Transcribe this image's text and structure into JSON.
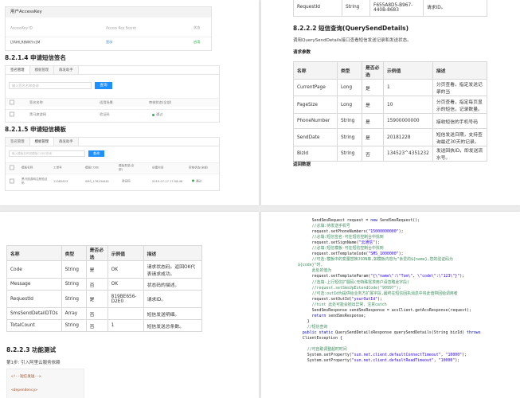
{
  "top_left": {
    "accesskey_panel": {
      "title": "用户AccessKey",
      "headers": [
        "AccessKey ID",
        "Access Key Secret",
        "状态"
      ],
      "row": {
        "id": "LTAIHLR8WKYn1M",
        "secret": "显示",
        "status": "启用"
      }
    },
    "sec_sign": {
      "heading": "8.2.1.4 申请短信签名",
      "tabs": [
        "签名管理",
        "模板管理",
        "群发助手"
      ],
      "search_placeholder": "输入签名名称查询",
      "search_button": "查询",
      "headers": [
        "签名名称",
        "适用场景",
        "审核状态(全部)"
      ],
      "row": {
        "name": "黑马旅游网",
        "scene": "验证码",
        "status": "通过"
      }
    },
    "sec_template": {
      "heading": "8.2.1.5 申请短信模板",
      "tabs": [
        "签名管理",
        "模板管理",
        "群发助手"
      ],
      "search_placeholder": "输入模板名称或模板CODE查询",
      "search_button": "查询",
      "headers": [
        "模板名称",
        "工单号",
        "模板CODE",
        "模板类型(全部)",
        "创建时间",
        "审核状态(全部)"
      ],
      "row": {
        "name": "黑马旅游网注册验证码",
        "order": "11582823",
        "code": "SMS_176534461",
        "type": "验证码",
        "time": "2019-07-17 17:58:46",
        "status": "通过"
      }
    }
  },
  "top_right": {
    "top_row": {
      "name": "RequestId",
      "type": "String",
      "example": "F655A8D5-B967-440B-8683",
      "desc": "请求ID。"
    },
    "section_title": "8.2.2.2 短信查询(QuerySendDetails)",
    "section_desc": "调用QuerySendDetails接口查看短信发送记录和发送状态。",
    "params_label": "请求参数",
    "headers": [
      "名称",
      "类型",
      "是否必选",
      "示例值",
      "描述"
    ],
    "rows": [
      {
        "name": "CurrentPage",
        "type": "Long",
        "required": "是",
        "example": "1",
        "desc": "分页查看，指定发送记录的当"
      },
      {
        "name": "PageSize",
        "type": "Long",
        "required": "是",
        "example": "10",
        "desc": "分页查看，指定每页显示的短信，记录数量。"
      },
      {
        "name": "PhoneNumber",
        "type": "String",
        "required": "是",
        "example": "15900000000",
        "desc": "接收短信的手机号码"
      },
      {
        "name": "SendDate",
        "type": "String",
        "required": "是",
        "example": "20181228",
        "desc": "短信发送日期，支持查询最近30天的记录。"
      },
      {
        "name": "BizId",
        "type": "String",
        "required": "否",
        "example": "134523^4351232",
        "desc": "发送回执ID，即发送流水号。"
      }
    ],
    "return_label": "返回数据"
  },
  "bottom_left": {
    "headers": [
      "名称",
      "类型",
      "是否必选",
      "示例值",
      "描述"
    ],
    "rows": [
      {
        "name": "Code",
        "type": "String",
        "required": "是",
        "example": "OK",
        "desc": "请求状态码。返回OK代表请求成功。"
      },
      {
        "name": "Message",
        "type": "String",
        "required": "否",
        "example": "OK",
        "desc": "状态码的描述。"
      },
      {
        "name": "RequestId",
        "type": "String",
        "required": "是",
        "example": "819BE656-D2E0",
        "desc": "请求ID。"
      },
      {
        "name": "SmsSendDetailDTOs",
        "type": "Array",
        "required": "否",
        "example": "",
        "desc": "短信发送明细。"
      },
      {
        "name": "TotalCount",
        "type": "String",
        "required": "否",
        "example": "1",
        "desc": "短信发送总条数。"
      }
    ],
    "section_title": "8.2.2.3 功能测试",
    "step1": "第1步: 引入阿里云服务依赖",
    "xml_lines": [
      "<!--短信发送-->",
      "<dependency>"
    ]
  },
  "bottom_right": {
    "code_lines": [
      {
        "indent": 6,
        "parts": [
          [
            "pl",
            "SendSmsRequest request = "
          ],
          [
            "kw",
            "new"
          ],
          [
            "pl",
            " SendSmsRequest();"
          ]
        ]
      },
      {
        "indent": 6,
        "parts": [
          [
            "cm",
            "//必填:待发送手机号"
          ]
        ]
      },
      {
        "indent": 6,
        "parts": [
          [
            "pl",
            "request.setPhoneNumbers("
          ],
          [
            "st",
            "\"15000000000\""
          ],
          [
            "pl",
            ");"
          ]
        ]
      },
      {
        "indent": 6,
        "parts": [
          [
            "cm",
            "//必填:短信签名-可在短信控制台中找到"
          ]
        ]
      },
      {
        "indent": 6,
        "parts": [
          [
            "pl",
            "request.setSignName("
          ],
          [
            "st",
            "\"云通信\""
          ],
          [
            "pl",
            ");"
          ]
        ]
      },
      {
        "indent": 6,
        "parts": [
          [
            "cm",
            "//必填:短信模板-可在短信控制台中找到"
          ]
        ]
      },
      {
        "indent": 6,
        "parts": [
          [
            "pl",
            "request.setTemplateCode("
          ],
          [
            "st",
            "\"SMS_1000000\""
          ],
          [
            "pl",
            ");"
          ]
        ]
      },
      {
        "indent": 6,
        "parts": [
          [
            "cm",
            "//可选:模板中的变量替换JSON串,如模板内容为\"亲爱的${name},您的验证码为"
          ]
        ]
      },
      {
        "indent": 0,
        "parts": [
          [
            "cm",
            "${code}\"时,"
          ]
        ]
      },
      {
        "indent": 6,
        "parts": [
          [
            "cm",
            "此处的值为"
          ]
        ]
      },
      {
        "indent": 6,
        "parts": [
          [
            "pl",
            "request.setTemplateParam("
          ],
          [
            "st",
            "\"{\\\"name\\\":\\\"Tom\\\", \\\"code\\\":\\\"123\\\"}\""
          ],
          [
            "pl",
            ");"
          ]
        ]
      },
      {
        "indent": 6,
        "parts": [
          [
            "cm",
            "//选填-上行短信扩展码(无特殊需求用户请忽略此字段)"
          ]
        ]
      },
      {
        "indent": 6,
        "parts": [
          [
            "cm",
            "//request.setSmsUpExtendCode(\"90997\");"
          ]
        ]
      },
      {
        "indent": 6,
        "parts": [
          [
            "cm",
            "//可选:outId为提供给业务方扩展字段,最终在短信回执消息中将此值带回给调用者"
          ]
        ]
      },
      {
        "indent": 6,
        "parts": [
          [
            "pl",
            "request.setOutId("
          ],
          [
            "st",
            "\"yourOutId\""
          ],
          [
            "pl",
            ");"
          ]
        ]
      },
      {
        "indent": 6,
        "parts": [
          [
            "cm",
            "//hint 此处可能会抛出异常，注意catch"
          ]
        ]
      },
      {
        "indent": 6,
        "parts": [
          [
            "pl",
            "SendSmsResponse sendSmsResponse = acsClient.getAcsResponse(request);"
          ]
        ]
      },
      {
        "indent": 6,
        "parts": [
          [
            "kw",
            "return"
          ],
          [
            "pl",
            " sendSmsResponse;"
          ]
        ]
      },
      {
        "indent": 4,
        "parts": [
          [
            "pl",
            "}"
          ]
        ]
      },
      {
        "indent": 4,
        "parts": [
          [
            "cm",
            "//短信查询"
          ]
        ]
      },
      {
        "indent": 2,
        "parts": [
          [
            "kw",
            "public static"
          ],
          [
            "pl",
            " QuerySendDetailsResponse querySendDetails(String bizId) "
          ],
          [
            "kw",
            "throws"
          ]
        ]
      },
      {
        "indent": 2,
        "parts": [
          [
            "pl",
            "ClientException {"
          ]
        ]
      },
      {
        "indent": 0,
        "parts": [
          [
            "pl",
            ""
          ]
        ]
      },
      {
        "indent": 4,
        "parts": [
          [
            "cm",
            "//可自助调整超时时间"
          ]
        ]
      },
      {
        "indent": 4,
        "parts": [
          [
            "pl",
            "System.setProperty("
          ],
          [
            "st",
            "\"sun.net.client.defaultConnectTimeout\""
          ],
          [
            "pl",
            ", "
          ],
          [
            "st",
            "\"10000\""
          ],
          [
            "pl",
            ");"
          ]
        ]
      },
      {
        "indent": 4,
        "parts": [
          [
            "pl",
            "System.setProperty("
          ],
          [
            "st",
            "\"sun.net.client.defaultReadTimeout\""
          ],
          [
            "pl",
            ", "
          ],
          [
            "st",
            "\"10000\""
          ],
          [
            "pl",
            ");"
          ]
        ]
      }
    ]
  },
  "colors": {
    "accent": "#1e90ff",
    "link": "#1e73c8",
    "ok": "#2bb24c",
    "comment": "#3f8f5f",
    "keyword": "#0000c0",
    "string": "#2a00ff"
  }
}
